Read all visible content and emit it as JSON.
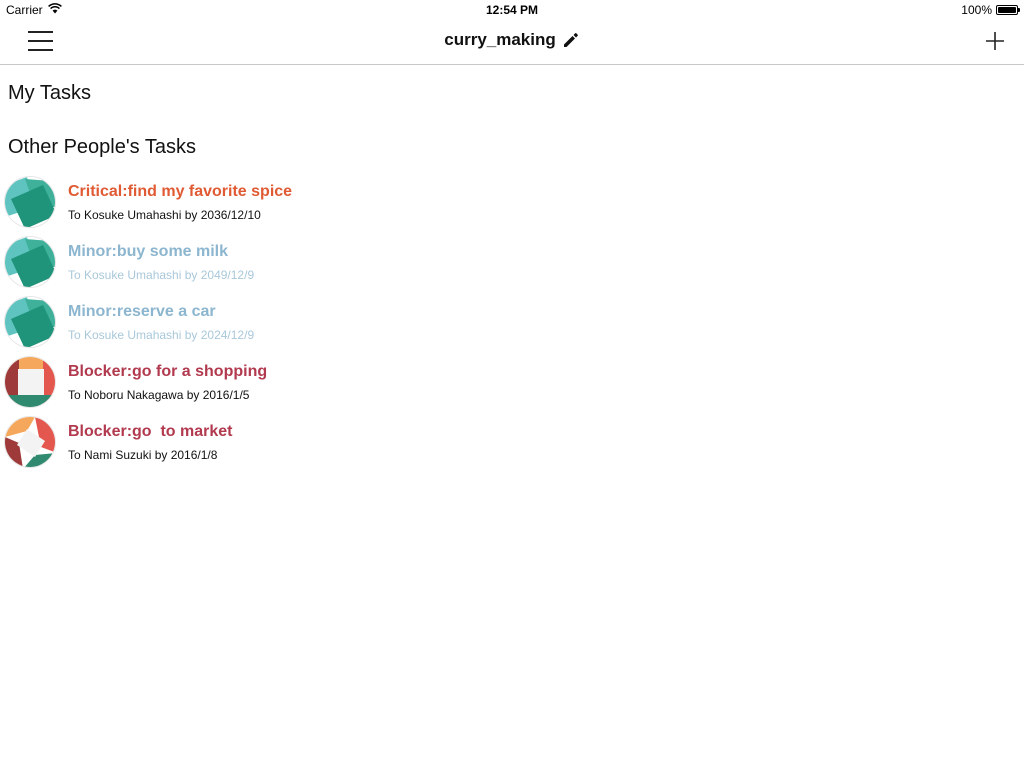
{
  "status_bar": {
    "carrier": "Carrier",
    "time": "12:54 PM",
    "battery": "100%",
    "battery_level": 1.0
  },
  "nav": {
    "title": "curry_making",
    "menu_icon": "hamburger-menu-icon",
    "edit_icon": "pencil-icon",
    "add_icon": "plus-icon"
  },
  "sections": {
    "my_tasks": "My Tasks",
    "other_tasks": "Other People's Tasks"
  },
  "colors": {
    "critical": "#e05a33",
    "minor_title": "#8cb6cf",
    "minor_sub": "#a9c8da",
    "blocker": "#b23a4f",
    "normal_sub": "#111111"
  },
  "tasks": [
    {
      "title": "Critical:find my favorite spice",
      "subtitle": "To Kosuke Umahashi by 2036/12/10",
      "priority": "Critical",
      "avatar": "teal"
    },
    {
      "title": "Minor:buy some milk",
      "subtitle": "To Kosuke Umahashi by 2049/12/9",
      "priority": "Minor",
      "avatar": "teal"
    },
    {
      "title": "Minor:reserve a car",
      "subtitle": "To Kosuke Umahashi by 2024/12/9",
      "priority": "Minor",
      "avatar": "teal"
    },
    {
      "title": "Blocker:go for a shopping",
      "subtitle": "To Noboru Nakagawa by 2016/1/5",
      "priority": "Blocker",
      "avatar": "warm"
    },
    {
      "title": "Blocker:go  to market",
      "subtitle": "To Nami Suzuki by 2016/1/8",
      "priority": "Blocker",
      "avatar": "warm-rotated"
    }
  ]
}
